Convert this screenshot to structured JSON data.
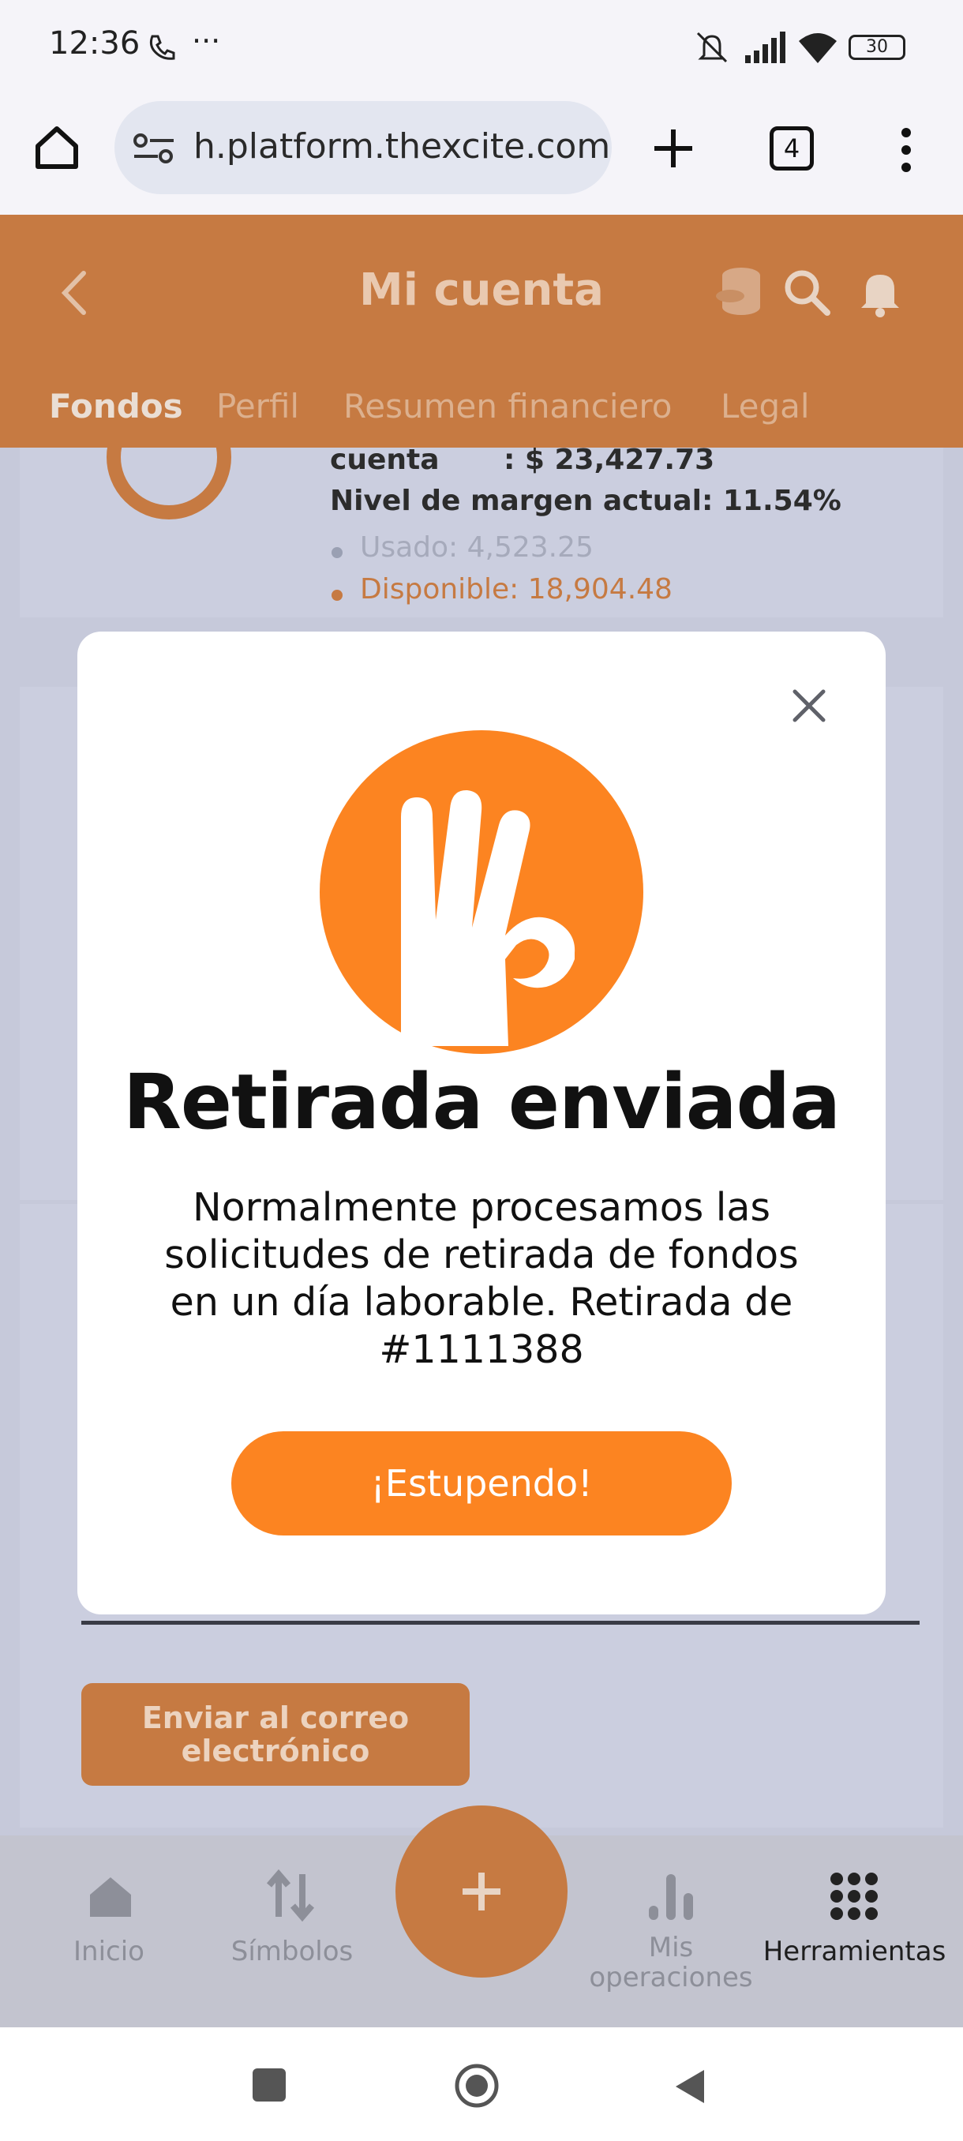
{
  "status_bar": {
    "time": "12:36",
    "battery": "30"
  },
  "browser": {
    "url": "h.platform.thexcite.com",
    "tab_count": "4"
  },
  "header": {
    "title": "Mi cuenta"
  },
  "tabs": [
    {
      "label": "Fondos",
      "active": true
    },
    {
      "label": "Perfil"
    },
    {
      "label": "Resumen financiero"
    },
    {
      "label": "Legal"
    }
  ],
  "account": {
    "equity_label": "cuenta",
    "equity_value": ": $ 23,427.73",
    "margin_level": "Nivel de margen actual: 11.54%",
    "used": "Usado: 4,523.25",
    "available": "Disponible: 18,904.48"
  },
  "send_email_button": "Enviar al correo electrónico",
  "bottom_nav": [
    {
      "label": "Inicio"
    },
    {
      "label": "Símbolos"
    },
    {
      "label": "Mis operaciones"
    },
    {
      "label": "Herramientas"
    }
  ],
  "modal": {
    "title": "Retirada enviada",
    "body": "Normalmente procesamos las solicitudes de retirada de fondos en un día laborable. Retirada de #1111388",
    "button": "¡Estupendo!"
  },
  "colors": {
    "brand": "#fc8421",
    "header_dim": "#c67a42",
    "overlay": "#c6c9da"
  },
  "icons": [
    "home-icon",
    "site-settings-icon",
    "new-tab-icon",
    "tabs-icon",
    "menu-icon",
    "back-icon",
    "coins-icon",
    "search-icon",
    "bell-icon",
    "close-icon",
    "ok-hand-icon",
    "symbols-icon",
    "plus-icon",
    "chart-icon",
    "grid-icon"
  ]
}
